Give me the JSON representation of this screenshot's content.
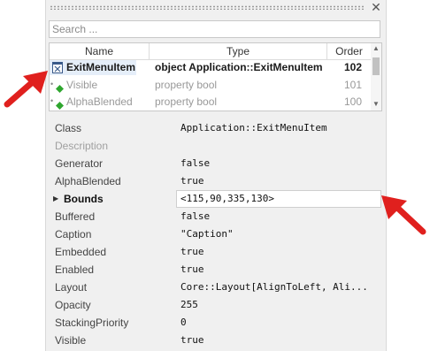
{
  "search": {
    "placeholder": "Search ..."
  },
  "tree": {
    "columns": [
      "Name",
      "Type",
      "Order"
    ],
    "rows": [
      {
        "name": "ExitMenuItem",
        "type": "object Application::ExitMenuItem",
        "order": "102"
      },
      {
        "name": "Visible",
        "type": "property bool",
        "order": "101"
      },
      {
        "name": "AlphaBlended",
        "type": "property bool",
        "order": "100"
      }
    ]
  },
  "properties": [
    {
      "name": "Class",
      "value": "Application::ExitMenuItem"
    },
    {
      "name": "Description",
      "value": ""
    },
    {
      "name": "Generator",
      "value": "false"
    },
    {
      "name": "AlphaBlended",
      "value": "true"
    },
    {
      "name": "Bounds",
      "value": "<115,90,335,130>"
    },
    {
      "name": "Buffered",
      "value": "false"
    },
    {
      "name": "Caption",
      "value": "\"Caption\""
    },
    {
      "name": "Embedded",
      "value": "true"
    },
    {
      "name": "Enabled",
      "value": "true"
    },
    {
      "name": "Layout",
      "value": "Core::Layout[AlignToLeft, Ali..."
    },
    {
      "name": "Opacity",
      "value": "255"
    },
    {
      "name": "StackingPriority",
      "value": "0"
    },
    {
      "name": "Visible",
      "value": "true"
    }
  ],
  "colors": {
    "accent_arrow": "#e0201e",
    "diamond": "#2fa62f",
    "selection": "#e5eef9"
  }
}
